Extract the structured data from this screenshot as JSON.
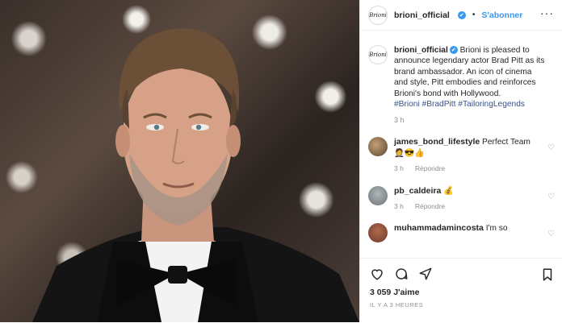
{
  "header": {
    "username": "brioni_official",
    "verified": "✔",
    "separator": "•",
    "follow_label": "S'abonner",
    "more_label": "···",
    "avatar_text": "Brioni"
  },
  "caption": {
    "username": "brioni_official",
    "text": " Brioni is pleased to announce legendary actor Brad Pitt as its brand ambassador. An icon of cinema and style, Pitt embodies and reinforces Brioni's bond with Hollywood.",
    "tags": "#Brioni #BradPitt #TailoringLegends",
    "time": "3 h"
  },
  "comments": [
    {
      "username": "james_bond_lifestyle",
      "text": " Perfect Team 🤵😎👍",
      "time": "3 h",
      "reply": "Répondre"
    },
    {
      "username": "pb_caldeira",
      "text": " 💰",
      "time": "3 h",
      "reply": "Répondre"
    },
    {
      "username": "muhammadamincosta",
      "text": " I'm so",
      "time": "",
      "reply": ""
    }
  ],
  "footer": {
    "likes": "3 059 J'aime",
    "ago": "IL Y A 3 HEURES"
  },
  "icons": [
    "heart-icon",
    "comment-icon",
    "share-icon",
    "bookmark-icon"
  ],
  "colors": {
    "link": "#3897f0",
    "hashtag": "#385185",
    "muted": "#8e8e8e"
  }
}
